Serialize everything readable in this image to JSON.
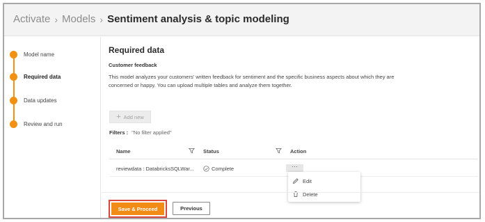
{
  "breadcrumb": {
    "items": [
      "Activate",
      "Models"
    ],
    "current": "Sentiment analysis & topic modeling"
  },
  "steps": [
    {
      "label": "Model name",
      "active": false
    },
    {
      "label": "Required data",
      "active": true
    },
    {
      "label": "Data updates",
      "active": false
    },
    {
      "label": "Review and run",
      "active": false
    }
  ],
  "main": {
    "title": "Required data",
    "subtitle": "Customer feedback",
    "description": "This model analyzes your customers' written feedback for sentiment and the specific business aspects about which they are concerned or happy. You can upload multiple tables and analyze them together.",
    "add_new_label": "Add new",
    "filters_label": "Filters :",
    "filters_value": "\"No filter applied\""
  },
  "table": {
    "columns": [
      "Name",
      "Status",
      "Action"
    ],
    "rows": [
      {
        "name": "reviewdata : DatabricksSQLWar...",
        "status": "Complete",
        "action": "···"
      }
    ]
  },
  "action_menu": {
    "items": [
      {
        "label": "Edit",
        "icon": "pencil-icon"
      },
      {
        "label": "Delete",
        "icon": "trash-icon"
      }
    ]
  },
  "footer": {
    "save_label": "Save & Proceed",
    "previous_label": "Previous"
  },
  "colors": {
    "accent": "#f28c16",
    "step": "#f29111",
    "highlight_border": "#d9463b",
    "status_ok": "#777777"
  }
}
